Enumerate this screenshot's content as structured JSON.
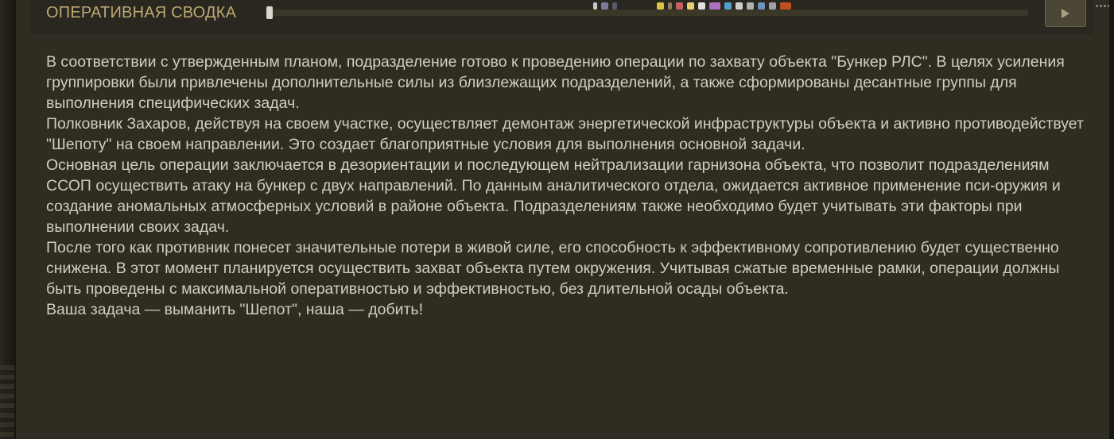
{
  "header": {
    "title": "ОПЕРАТИВНАЯ СВОДКА",
    "progress": 0.0
  },
  "briefing": {
    "paragraphs": [
      "В соответствии с утвержденным планом, подразделение готово к проведению операции по захвату объекта \"Бункер РЛС\". В целях усиления группировки были привлечены дополнительные силы из близлежащих подразделений, а также сформированы десантные группы для выполнения специфических задач.",
      "Полковник Захаров, действуя на своем участке, осуществляет демонтаж энергетической инфраструктуры объекта и активно противодействует \"Шепоту\" на своем направлении. Это создает благоприятные условия для выполнения основной задачи.",
      "Основная цель операции заключается в дезориентации и последующем нейтрализации гарнизона объекта, что позволит подразделениям ССОП осуществить атаку на бункер с двух направлений. По данным аналитического отдела, ожидается активное применение пси-оружия и создание аномальных атмосферных условий в районе объекта. Подразделениям также необходимо будет учитывать эти факторы при выполнении своих задач.",
      "После того как противник понесет значительные потери в живой силе, его способность к эффективному сопротивлению будет существенно снижена. В этот момент планируется осуществить захват объекта путем окружения. Учитывая сжатые временные рамки, операции должны быть проведены с максимальной оперативностью и эффективностью, без длительной осады объекта.",
      "Ваша задача — выманить \"Шепот\", наша — добить!"
    ]
  },
  "icons": {
    "play": "play-icon",
    "taskbar": [
      "tray-icon-1",
      "tray-icon-2",
      "tray-icon-3",
      "tray-icon-4",
      "tray-icon-5",
      "tray-icon-6",
      "tray-icon-7",
      "tray-icon-8",
      "tray-icon-9",
      "tray-icon-10",
      "tray-icon-11",
      "tray-icon-12",
      "tray-icon-13",
      "tray-icon-14",
      "tray-icon-15",
      "tray-icon-16"
    ]
  },
  "colors": {
    "title": "#bca870",
    "text": "#d0cdc2",
    "panel": "#2f2c22"
  }
}
